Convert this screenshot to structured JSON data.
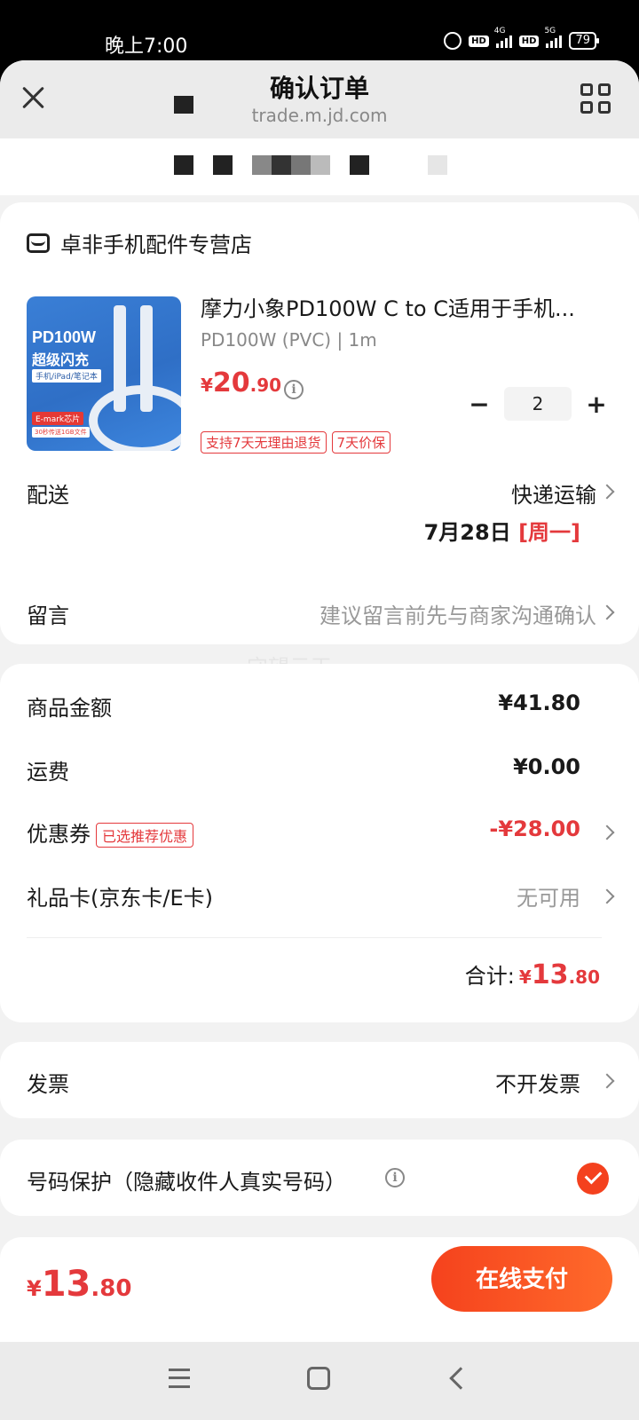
{
  "status_bar": {
    "time": "晚上7:00",
    "hd1": "HD",
    "net1": "4G",
    "hd2": "HD",
    "net2": "5G",
    "battery": "79"
  },
  "header": {
    "title": "确认订单",
    "url": "trade.m.jd.com"
  },
  "shop": {
    "name": "卓非手机配件专营店"
  },
  "product": {
    "name": "摩力小象PD100W C to C适用于手机...",
    "spec": "PD100W (PVC) | 1m",
    "price_symbol": "¥",
    "price_int": "20",
    "price_dec": ".90",
    "quantity": "2",
    "minus": "−",
    "plus": "+",
    "tags": [
      "支持7天无理由退货",
      "7天价保"
    ],
    "image_text": {
      "line1": "PD100W",
      "line2": "超级闪充",
      "line3": "手机/iPad/笔记本",
      "line4": "E-mark芯片",
      "line5": "30秒传送1GB文件"
    }
  },
  "delivery": {
    "label": "配送",
    "method": "快递运输",
    "date": "7月28日",
    "weekday": "[周一]"
  },
  "message": {
    "label": "留言",
    "placeholder": "建议留言前先与商家沟通确认"
  },
  "watermark": "守望云天",
  "summary": {
    "goods_label": "商品金额",
    "goods_value": "¥41.80",
    "shipping_label": "运费",
    "shipping_value": "¥0.00",
    "coupon_label": "优惠券",
    "coupon_badge": "已选推荐优惠",
    "coupon_value": "-¥28.00",
    "giftcard_label": "礼品卡(京东卡/E卡)",
    "giftcard_value": "无可用",
    "total_label": "合计:",
    "total_symbol": "¥",
    "total_int": "13",
    "total_dec": ".80"
  },
  "invoice": {
    "label": "发票",
    "value": "不开发票"
  },
  "privacy": {
    "label": "号码保护（隐藏收件人真实号码）"
  },
  "pay_bar": {
    "symbol": "¥",
    "amount_int": "13",
    "amount_dec": ".80",
    "button": "在线支付"
  },
  "colors": {
    "accent": "#e4393c",
    "pay_button": "#f5421d"
  }
}
